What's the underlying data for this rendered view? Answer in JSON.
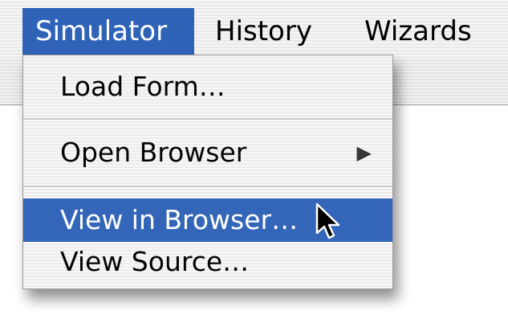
{
  "menubar": {
    "menus": [
      {
        "label": "Simulator",
        "active": true
      },
      {
        "label": "History",
        "active": false
      },
      {
        "label": "Wizards",
        "active": false
      }
    ]
  },
  "dropdown": {
    "items": [
      {
        "label": "Load Form…",
        "highlighted": false,
        "has_submenu": false
      },
      {
        "label": "Open Browser",
        "highlighted": false,
        "has_submenu": true,
        "submenu_icon": "triangle-right-icon"
      },
      {
        "label": "View in Browser…",
        "highlighted": true,
        "has_submenu": false
      },
      {
        "label": "View Source…",
        "highlighted": false,
        "has_submenu": false
      }
    ]
  },
  "pointer": {
    "icon": "arrow-cursor-icon"
  },
  "colors": {
    "highlight": "#2f63b7",
    "highlight_text": "#ffffff",
    "text": "#000000"
  }
}
